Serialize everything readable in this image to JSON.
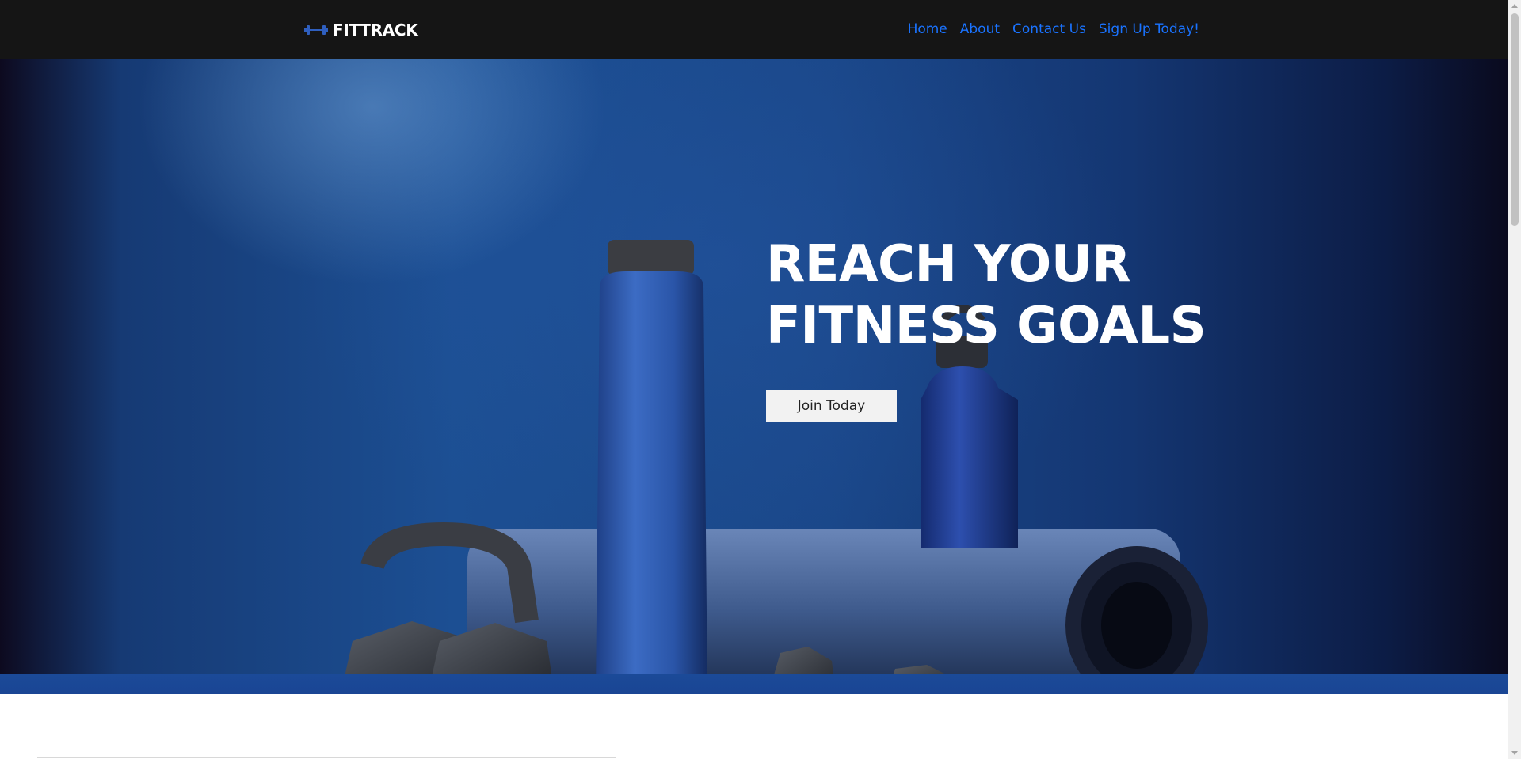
{
  "brand": {
    "name": "FITTRACK",
    "icon": "dumbbell-icon",
    "icon_color": "#2f5fbf"
  },
  "nav": {
    "links": [
      "Home",
      "About",
      "Contact Us",
      "Sign Up Today!"
    ],
    "link_color": "#1a73ff",
    "background": "#151515"
  },
  "hero": {
    "title_line1": "REACH YOUR",
    "title_line2": "FITNESS GOALS",
    "cta_label": "Join Today",
    "image_subject": "blue fitness equipment: water bottles, yoga mat, kettlebell, dumbbells"
  }
}
